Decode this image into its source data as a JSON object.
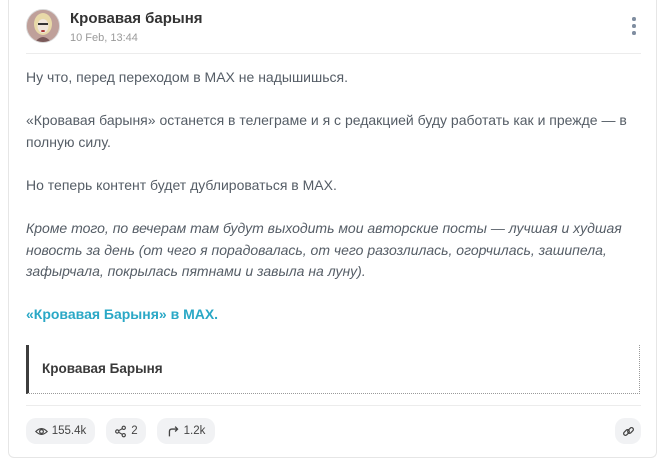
{
  "post": {
    "channel_name": "Кровавая барыня",
    "date": "10 Feb, 13:44",
    "paragraphs": [
      "Ну что, перед переходом в MAX не надышишься.",
      "«Кровавая барыня» останется в телеграме и я с редакцией буду работать как и прежде — в полную силу.",
      "Но теперь контент будет дублироваться в MAX.",
      "Кроме того, по вечерам там будут выходить мои авторские посты — лучшая и худшая новость за день (от чего я порадовалась, от чего разозлилась, огорчилась, зашипела, зафырчала, покрылась пятнами и завыла на луну)."
    ],
    "link_text": "«Кровавая Барыня» в MAX.",
    "quote_title": "Кровавая Барыня"
  },
  "stats": {
    "views": "155.4k",
    "reactions": "2",
    "shares": "1.2k"
  },
  "icons": {
    "avatar": "avatar-image",
    "menu": "more-vertical-icon",
    "views": "eye-icon",
    "reactions": "share-nodes-icon",
    "shares": "forward-arrow-icon",
    "link": "link-icon"
  },
  "colors": {
    "link": "#2aa8c6",
    "text": "#555d66",
    "quote_bar": "#3d3d3d"
  }
}
